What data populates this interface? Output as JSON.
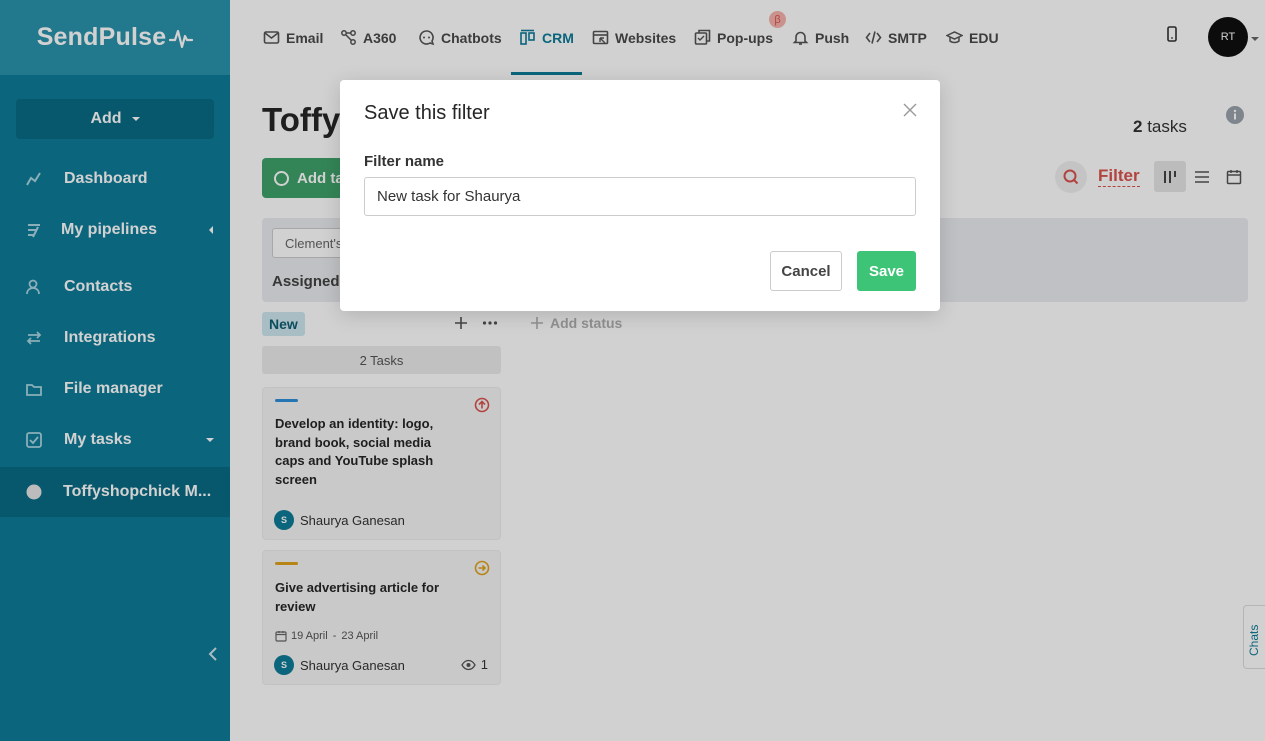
{
  "sidebar": {
    "logo": "SendPulse",
    "add_label": "Add",
    "items": [
      {
        "label": "Dashboard"
      },
      {
        "label": "My pipelines"
      },
      {
        "label": "Contacts"
      },
      {
        "label": "Integrations"
      },
      {
        "label": "File manager"
      },
      {
        "label": "My tasks"
      },
      {
        "label": "Toffyshopchick M..."
      }
    ]
  },
  "topnav": {
    "items": [
      {
        "label": "Email",
        "icon": "mail-icon"
      },
      {
        "label": "A360",
        "icon": "a360-icon"
      },
      {
        "label": "Chatbots",
        "icon": "chatbot-icon"
      },
      {
        "label": "CRM",
        "icon": "crm-icon"
      },
      {
        "label": "Websites",
        "icon": "website-icon"
      },
      {
        "label": "Pop-ups",
        "icon": "popup-icon"
      },
      {
        "label": "Push",
        "icon": "bell-icon"
      },
      {
        "label": "SMTP",
        "icon": "code-icon"
      },
      {
        "label": "EDU",
        "icon": "graduation-cap-icon"
      }
    ],
    "beta_badge": "β",
    "avatar_text": "RT"
  },
  "page": {
    "title": "Toffys",
    "task_count_num": "2",
    "task_count_label": "tasks",
    "add_task_label": "Add ta",
    "filter_label": "Filter",
    "filter_chip": "Clement's",
    "assigned_label": "Assigned"
  },
  "board": {
    "status_name": "New",
    "add_status_label": "Add status",
    "tasks_count_label": "2 Tasks",
    "cards": [
      {
        "title": "Develop an identity: logo, brand book, social media caps and YouTube splash screen",
        "assignee": "Shaurya Ganesan",
        "assignee_initial": "S",
        "bar_color": "#2f8fdb",
        "priority_color": "#d9534f"
      },
      {
        "title": "Give advertising article for review",
        "date_start": "19 April",
        "date_sep": "-",
        "date_end": "23 April",
        "assignee": "Shaurya Ganesan",
        "assignee_initial": "S",
        "views": "1",
        "bar_color": "#e0a21b",
        "priority_color": "#e0a21b"
      }
    ]
  },
  "chats_tab_label": "Chats",
  "modal": {
    "title": "Save this filter",
    "field_label": "Filter name",
    "field_value": "New task for Shaurya",
    "cancel_label": "Cancel",
    "save_label": "Save"
  },
  "colors": {
    "sidebar": "#0e7c98",
    "accent_red": "#d9534f",
    "save_green": "#3ec476"
  }
}
